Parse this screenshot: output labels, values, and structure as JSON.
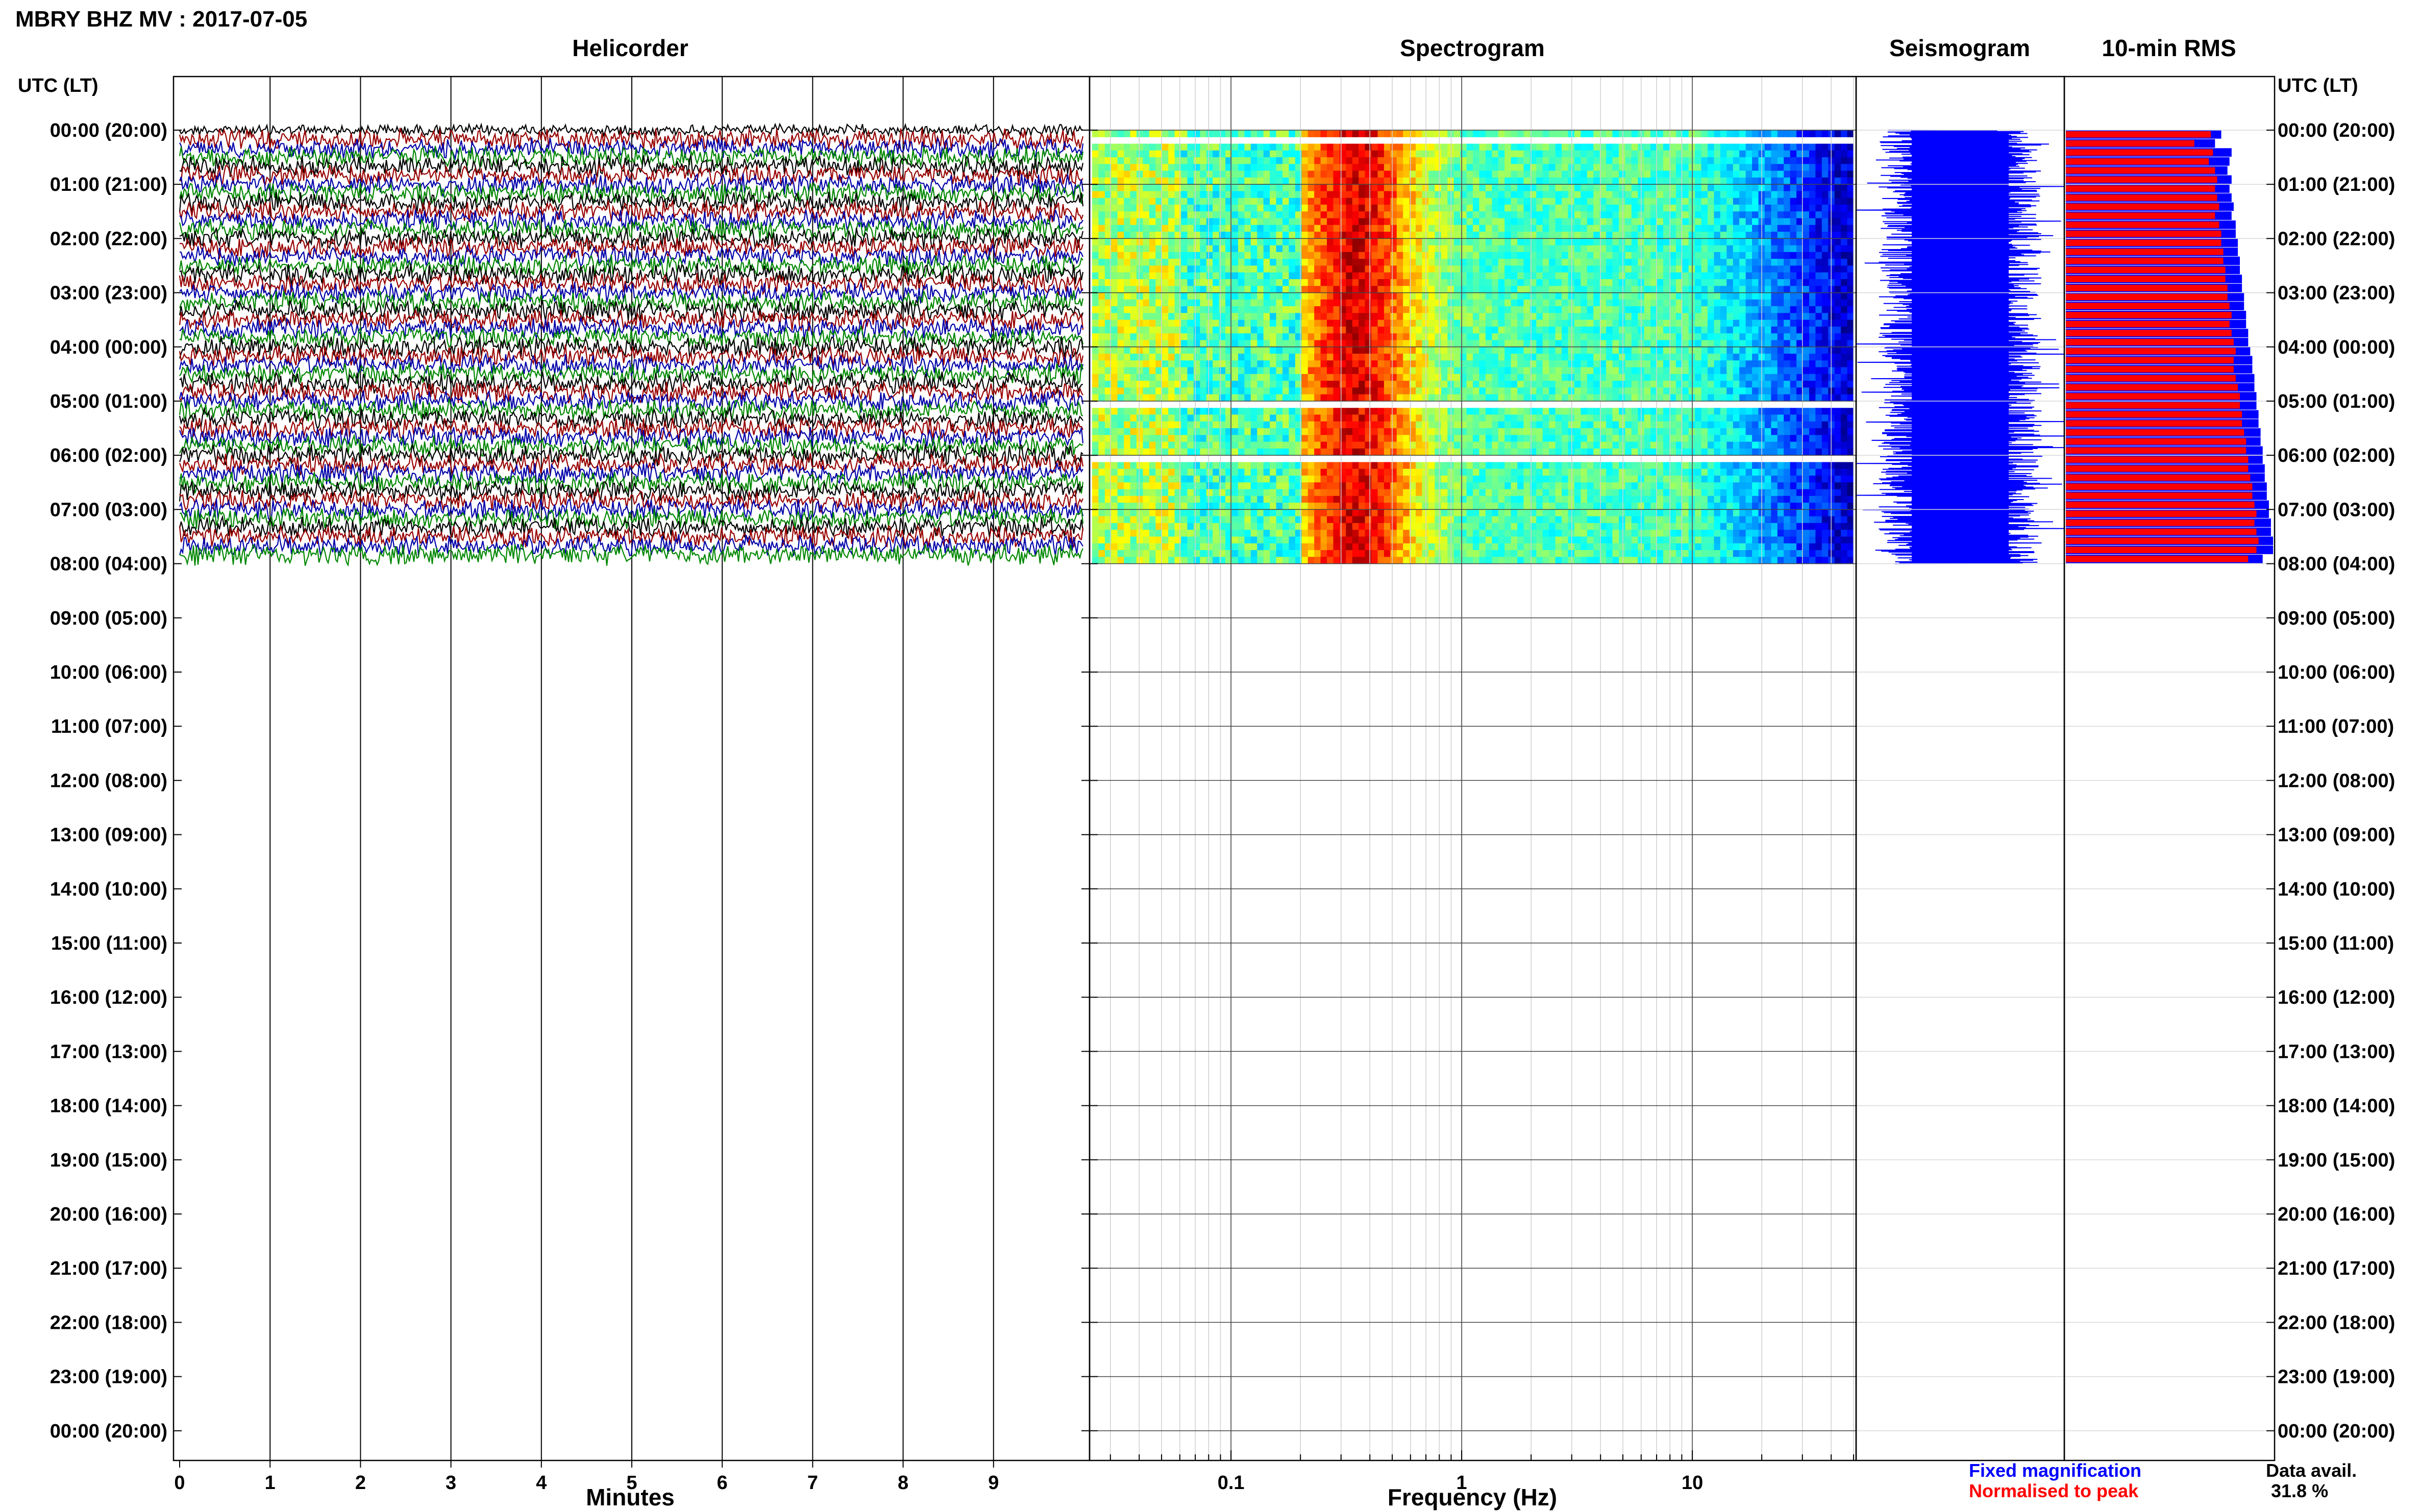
{
  "title": "MBRY BHZ MV : 2017-07-05",
  "panel_titles": {
    "helicorder": "Helicorder",
    "spectrogram": "Spectrogram",
    "seismogram": "Seismogram",
    "rms": "10-min RMS"
  },
  "axis_labels": {
    "time_header_left": "UTC (LT)",
    "time_header_right": "UTC (LT)",
    "helicorder_x": "Minutes",
    "spectrogram_x": "Frequency (Hz)"
  },
  "legend": {
    "fixed": "Fixed magnification",
    "normalised": "Normalised to peak"
  },
  "data_availability": {
    "label": "Data avail.",
    "value": "31.8 %"
  },
  "colors": {
    "fixed": "#0000ff",
    "normalised": "#ff0000",
    "trace_colors": [
      "#000000",
      "#990000",
      "#0000aa",
      "#008800"
    ]
  },
  "chart_data": [
    {
      "type": "line",
      "name": "helicorder",
      "xlabel": "Minutes",
      "x_ticks": [
        "0",
        "1",
        "2",
        "3",
        "4",
        "5",
        "6",
        "7",
        "8",
        "9"
      ],
      "xlim": [
        0,
        10
      ],
      "y_tick_labels": [
        "00:00 (20:00)",
        "01:00 (21:00)",
        "02:00 (22:00)",
        "03:00 (23:00)",
        "04:00 (00:00)",
        "05:00 (01:00)",
        "06:00 (02:00)",
        "07:00 (03:00)",
        "08:00 (04:00)",
        "09:00 (05:00)",
        "10:00 (06:00)",
        "11:00 (07:00)",
        "12:00 (08:00)",
        "13:00 (09:00)",
        "14:00 (10:00)",
        "15:00 (11:00)",
        "16:00 (12:00)",
        "17:00 (13:00)",
        "18:00 (14:00)",
        "19:00 (15:00)",
        "20:00 (16:00)",
        "21:00 (17:00)",
        "22:00 (18:00)",
        "23:00 (19:00)",
        "00:00 (20:00)"
      ],
      "data_hours": 8.0,
      "lines_per_hour": 6
    },
    {
      "type": "heatmap",
      "name": "spectrogram",
      "xlabel": "Frequency (Hz)",
      "x_scale": "log",
      "xlim": [
        0.025,
        50
      ],
      "x_ticks": [
        "0.1",
        "1",
        "10"
      ],
      "data_hours": 8.0,
      "gaps_hours": [
        [
          0.15,
          0.3
        ],
        [
          5.05,
          5.1
        ],
        [
          6.05,
          6.1
        ]
      ],
      "peak_band_hz": [
        0.22,
        0.55
      ]
    },
    {
      "type": "area",
      "name": "seismogram",
      "data_hours": 8.0
    },
    {
      "type": "bar",
      "name": "10-min RMS",
      "series": [
        {
          "name": "Fixed magnification",
          "values": [
            0.7,
            0.62,
            0.71,
            0.69,
            0.72,
            0.73,
            0.72,
            0.73,
            0.74,
            0.72,
            0.74,
            0.75,
            0.75,
            0.76,
            0.76,
            0.77,
            0.77,
            0.78,
            0.78,
            0.79,
            0.8,
            0.79,
            0.8,
            0.81,
            0.82,
            0.81,
            0.81,
            0.82,
            0.83,
            0.84,
            0.84,
            0.85,
            0.85,
            0.86,
            0.87,
            0.87,
            0.88,
            0.88,
            0.89,
            0.9,
            0.9,
            0.91,
            0.92,
            0.91,
            0.92,
            0.93,
            0.92,
            0.88
          ]
        },
        {
          "name": "Normalised to peak",
          "values": [
            0.75,
            0.72,
            0.8,
            0.79,
            0.78,
            0.8,
            0.79,
            0.8,
            0.81,
            0.8,
            0.82,
            0.82,
            0.83,
            0.83,
            0.84,
            0.84,
            0.85,
            0.85,
            0.86,
            0.86,
            0.87,
            0.87,
            0.88,
            0.88,
            0.89,
            0.9,
            0.9,
            0.91,
            0.91,
            0.92,
            0.92,
            0.93,
            0.93,
            0.94,
            0.94,
            0.95,
            0.95,
            0.96,
            0.96,
            0.97,
            0.97,
            0.98,
            0.98,
            0.99,
            0.99,
            1.0,
            1.0,
            0.95
          ]
        }
      ],
      "data_hours": 8.0
    }
  ]
}
